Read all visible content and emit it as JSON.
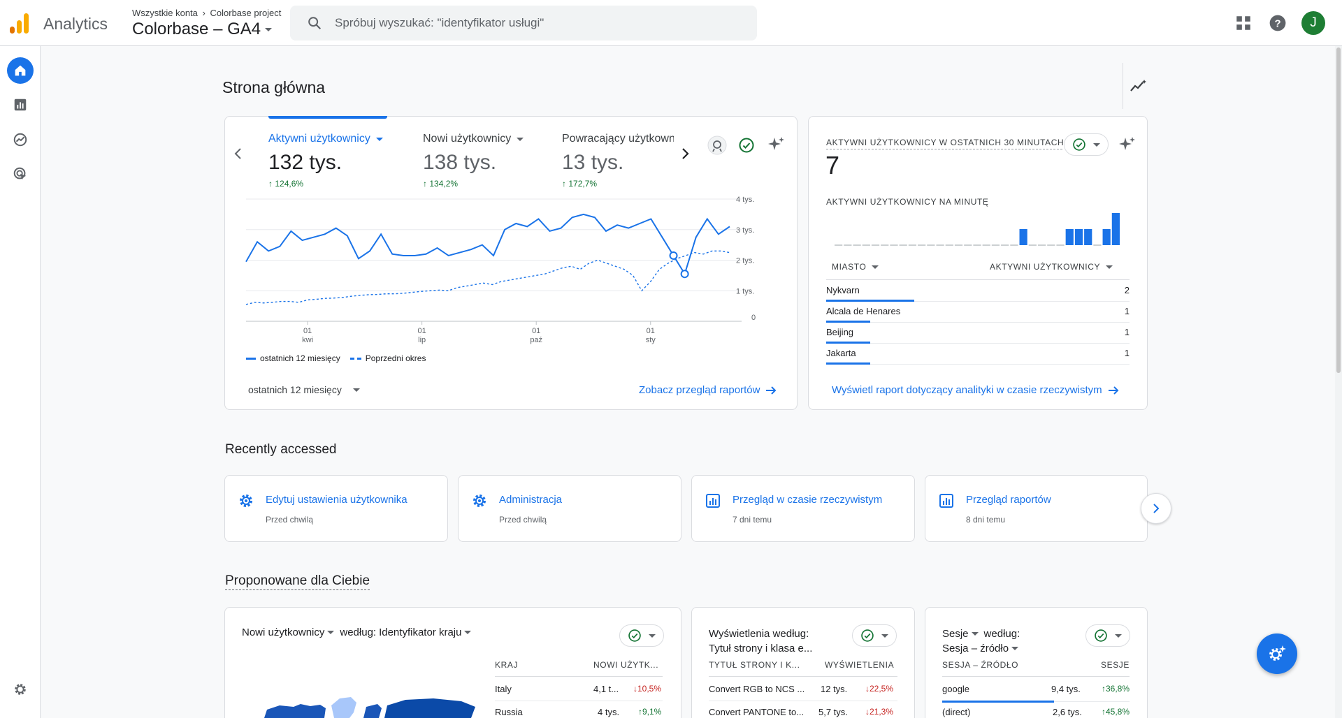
{
  "topbar": {
    "brand": "Analytics",
    "breadcrumb_all": "Wszystkie konta",
    "breadcrumb_project": "Colorbase project",
    "property": "Colorbase – GA4",
    "search_placeholder": "Spróbuj wyszukać: \"identyfikator usługi\"",
    "avatar_letter": "J"
  },
  "page_title": "Strona główna",
  "overview": {
    "metrics": [
      {
        "label": "Aktywni użytkownicy",
        "value": "132 tys.",
        "delta": "124,6%"
      },
      {
        "label": "Nowi użytkownicy",
        "value": "138 tys.",
        "delta": "134,2%"
      },
      {
        "label": "Powracający użytkowni",
        "value": "13 tys.",
        "delta": "172,7%"
      }
    ],
    "legend_current": "ostatnich 12 miesięcy",
    "legend_previous": "Poprzedni okres",
    "date_range": "ostatnich 12 miesięcy",
    "view_link": "Zobacz przegląd raportów"
  },
  "chart_data": {
    "type": "line",
    "y_ticks": [
      "4 tys.",
      "3 tys.",
      "2 tys.",
      "1 tys.",
      "0"
    ],
    "ylim": [
      0,
      4000
    ],
    "x_ticks": [
      {
        "day": "01",
        "month": "kwi",
        "index": 7
      },
      {
        "day": "01",
        "month": "lip",
        "index": 20
      },
      {
        "day": "01",
        "month": "paź",
        "index": 33
      },
      {
        "day": "01",
        "month": "sty",
        "index": 46
      }
    ],
    "series": [
      {
        "name": "ostatnich 12 miesięcy",
        "style": "solid",
        "values": [
          1950,
          2600,
          2300,
          2450,
          2950,
          2650,
          2750,
          2850,
          3050,
          2800,
          2050,
          2300,
          2850,
          2200,
          2150,
          2150,
          2200,
          2400,
          2150,
          2250,
          2350,
          2500,
          2150,
          3000,
          3200,
          3100,
          3350,
          2950,
          3050,
          3400,
          3500,
          3400,
          2950,
          3150,
          3050,
          3200,
          3350,
          2750,
          2150,
          1550,
          2750,
          3350,
          2850,
          3100
        ]
      },
      {
        "name": "Poprzedni okres",
        "style": "dashed",
        "values": [
          550,
          620,
          600,
          620,
          650,
          650,
          620,
          700,
          720,
          750,
          760,
          780,
          820,
          850,
          870,
          880,
          900,
          900,
          920,
          950,
          980,
          1000,
          1020,
          1000,
          1100,
          1150,
          1200,
          1250,
          1200,
          1300,
          1350,
          1400,
          1450,
          1500,
          1550,
          1650,
          1750,
          1800,
          1700,
          1900,
          2000,
          1900,
          1800,
          1700,
          1500,
          1000,
          1300,
          1700,
          1900,
          2050,
          2150,
          2250,
          2200,
          2300,
          2300,
          2250
        ]
      }
    ]
  },
  "realtime": {
    "title": "Aktywni użytkownicy w ostatnich 30 minutach",
    "count": "7",
    "per_minute_label": "Aktywni użytkownicy na minutę",
    "per_minute": [
      0,
      0,
      0,
      0,
      0,
      0,
      0,
      0,
      0,
      0,
      0,
      0,
      0,
      0,
      0,
      0,
      0,
      0,
      0,
      0,
      1,
      0,
      0,
      0,
      0,
      1,
      1,
      1,
      0,
      1,
      2
    ],
    "col_city": "Miasto",
    "col_users": "Aktywni użytkownicy",
    "rows": [
      {
        "city": "Nykvarn",
        "users": "2",
        "share": 0.29
      },
      {
        "city": "Alcala de Henares",
        "users": "1",
        "share": 0.145
      },
      {
        "city": "Beijing",
        "users": "1",
        "share": 0.145
      },
      {
        "city": "Jakarta",
        "users": "1",
        "share": 0.145
      }
    ],
    "link": "Wyświetl raport dotyczący analityki w czasie rzeczywistym"
  },
  "recent": {
    "title": "Recently accessed",
    "items": [
      {
        "title": "Edytuj ustawienia użytkownika",
        "sub": "Przed chwilą",
        "icon": "gear-icon"
      },
      {
        "title": "Administracja",
        "sub": "Przed chwilą",
        "icon": "gear-icon"
      },
      {
        "title": "Przegląd w czasie rzeczywistym",
        "sub": "7 dni temu",
        "icon": "bar-chart-icon"
      },
      {
        "title": "Przegląd raportów",
        "sub": "8 dni temu",
        "icon": "bar-chart-icon"
      }
    ]
  },
  "suggested": {
    "title": "Proponowane dla Ciebie",
    "card1": {
      "metric": "Nowi użytkownicy",
      "by": "według:",
      "dimension": "Identyfikator kraju",
      "col1": "KRAJ",
      "col2": "NOWI UŻYTK...",
      "rows": [
        {
          "name": "Italy",
          "value": "4,1 t...",
          "delta": "10,5%",
          "dir": "down"
        },
        {
          "name": "Russia",
          "value": "4 tys.",
          "delta": "9,1%",
          "dir": "up"
        }
      ]
    },
    "card2": {
      "title_line1": "Wyświetlenia według:",
      "title_line2": "Tytuł strony i klasa e...",
      "col1": "TYTUŁ STRONY I K...",
      "col2": "WYŚWIETLENIA",
      "rows": [
        {
          "name": "Convert RGB to NCS ...",
          "value": "12 tys.",
          "delta": "22,5%",
          "dir": "down"
        },
        {
          "name": "Convert PANTONE to...",
          "value": "5,7 tys.",
          "delta": "21,3%",
          "dir": "down"
        }
      ]
    },
    "card3": {
      "title_line1": "Sesje",
      "title_by": "według:",
      "title_line2": "Sesja – źródło",
      "col1": "SESJA – ŹRÓDŁO",
      "col2": "SESJE",
      "rows": [
        {
          "name": "google",
          "value": "9,4 tys.",
          "delta": "36,8%",
          "dir": "up"
        },
        {
          "name": "(direct)",
          "value": "2,6 tys.",
          "delta": "45,8%",
          "dir": "up"
        }
      ]
    }
  },
  "colors": {
    "accent": "#1a73e8",
    "positive": "#137333",
    "negative": "#c5221f",
    "avatar": "#1e7e34"
  }
}
